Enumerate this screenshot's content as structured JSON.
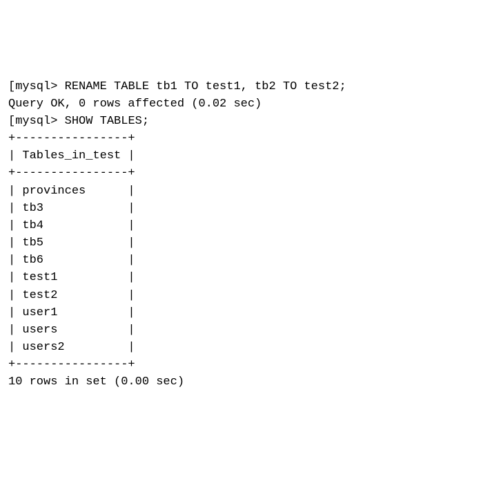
{
  "terminal": {
    "prompt_open": "[",
    "prompt_label": "mysql>",
    "cmd1": "RENAME TABLE tb1 TO test1, tb2 TO test2;",
    "result1": "Query OK, 0 rows affected (0.02 sec)",
    "blank": "",
    "cmd2": "SHOW TABLES;",
    "table": {
      "border_top": "+----------------+",
      "header_row": "| Tables_in_test |",
      "header_sep": "+----------------+",
      "rows": [
        "| provinces      |",
        "| tb3            |",
        "| tb4            |",
        "| tb5            |",
        "| tb6            |",
        "| test1          |",
        "| test2          |",
        "| user1          |",
        "| users          |",
        "| users2         |"
      ],
      "border_bottom": "+----------------+"
    },
    "result2": "10 rows in set (0.00 sec)"
  }
}
